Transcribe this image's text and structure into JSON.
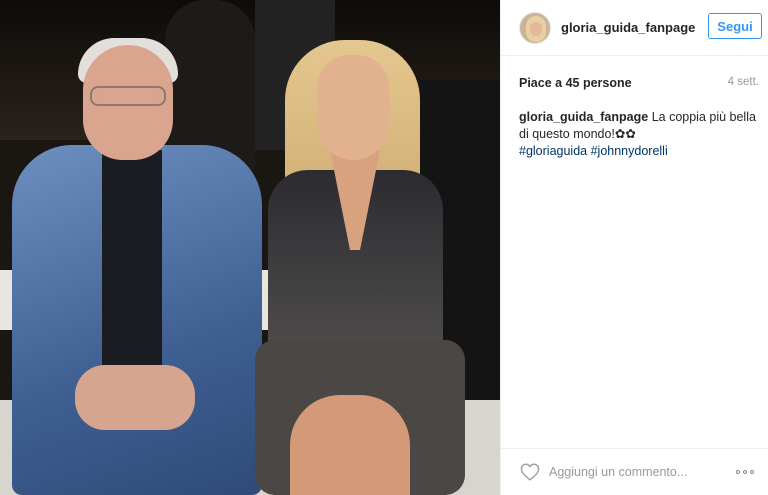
{
  "post": {
    "photo_icon": "photo-image"
  },
  "header": {
    "username": "gloria_guida_fanpage",
    "follow_label": "Segui",
    "avatar_icon": "avatar-image"
  },
  "meta": {
    "likes": "Piace a 45 persone",
    "time": "4 sett."
  },
  "caption": {
    "author": "gloria_guida_fanpage",
    "text": "La coppia più bella di questo mondo!✿✿",
    "hashtags": [
      "#gloriaguida",
      "#johnnydorelli"
    ]
  },
  "footer": {
    "like_icon": "heart-icon",
    "comment_placeholder": "Aggiungi un commento...",
    "more_icon": "ellipsis-icon"
  },
  "colors": {
    "accent": "#3897f0",
    "hashtag": "#003569",
    "muted": "#999999",
    "text": "#262626",
    "border": "#efefef"
  }
}
